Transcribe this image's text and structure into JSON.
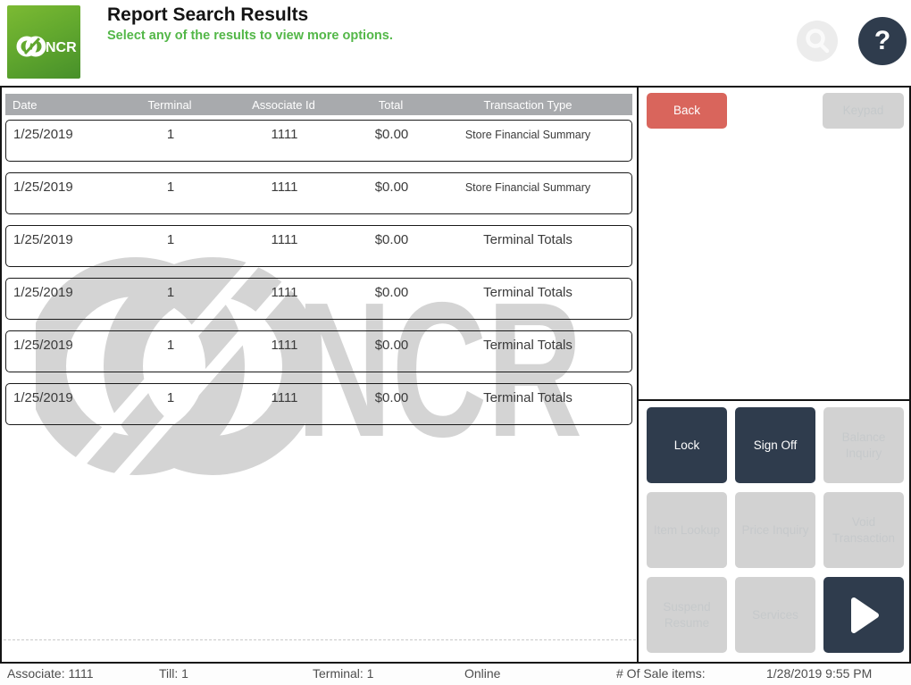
{
  "colors": {
    "accent_green": "#53b748",
    "logo_green_top": "#7cba33",
    "logo_green_bottom": "#47902a",
    "back_button_red": "#d9655c",
    "dark_navy": "#2f3c4d",
    "disabled_gray": "#d2d2d2",
    "disabled_text": "#c6c9cb",
    "table_header_gray": "#a8aaad",
    "watermark_gray": "#d4d4d4"
  },
  "icons": {
    "search": "magnifier-glyph",
    "help": "question-mark",
    "next": "play-arrow-triangle",
    "logo": "ncr-interlocking-rings"
  },
  "header": {
    "logo_text": "NCR",
    "title": "Report Search Results",
    "subtitle": "Select any of the results to view more options.",
    "help_label": "?"
  },
  "table": {
    "headers": [
      "Date",
      "Terminal",
      "Associate Id",
      "Total",
      "Transaction Type"
    ],
    "rows": [
      {
        "date": "1/25/2019",
        "terminal": "1",
        "associate_id": "1111",
        "total": "$0.00",
        "transaction_type": "Store Financial Summary"
      },
      {
        "date": "1/25/2019",
        "terminal": "1",
        "associate_id": "1111",
        "total": "$0.00",
        "transaction_type": "Store Financial Summary"
      },
      {
        "date": "1/25/2019",
        "terminal": "1",
        "associate_id": "1111",
        "total": "$0.00",
        "transaction_type": "Terminal Totals"
      },
      {
        "date": "1/25/2019",
        "terminal": "1",
        "associate_id": "1111",
        "total": "$0.00",
        "transaction_type": "Terminal Totals"
      },
      {
        "date": "1/25/2019",
        "terminal": "1",
        "associate_id": "1111",
        "total": "$0.00",
        "transaction_type": "Terminal Totals"
      },
      {
        "date": "1/25/2019",
        "terminal": "1",
        "associate_id": "1111",
        "total": "$0.00",
        "transaction_type": "Terminal Totals"
      }
    ]
  },
  "side_panel": {
    "back_label": "Back",
    "keypad_label": "Keypad",
    "buttons": [
      {
        "label": "Lock",
        "name": "lock-button",
        "style": "dark"
      },
      {
        "label": "Sign Off",
        "name": "sign-off-button",
        "style": "dark"
      },
      {
        "label": "Balance Inquiry",
        "name": "balance-inquiry-button",
        "style": "disabled"
      },
      {
        "label": "Item Lookup",
        "name": "item-lookup-button",
        "style": "disabled"
      },
      {
        "label": "Price Inquiry",
        "name": "price-inquiry-button",
        "style": "disabled"
      },
      {
        "label": "Void Transaction",
        "name": "void-transaction-button",
        "style": "disabled"
      },
      {
        "label": "Suspend Resume",
        "name": "suspend-resume-button",
        "style": "disabled"
      },
      {
        "label": "Services",
        "name": "services-button",
        "style": "disabled"
      },
      {
        "label": "",
        "name": "next-page-button",
        "style": "dark",
        "icon": "play-arrow-icon"
      }
    ]
  },
  "status_bar": {
    "associate": "Associate: 1111",
    "till": "Till: 1",
    "terminal": "Terminal: 1",
    "connection": "Online",
    "sale_items": "# Of Sale items:",
    "datetime": "1/28/2019 9:55 PM"
  },
  "watermark": {
    "text": "NCR"
  }
}
